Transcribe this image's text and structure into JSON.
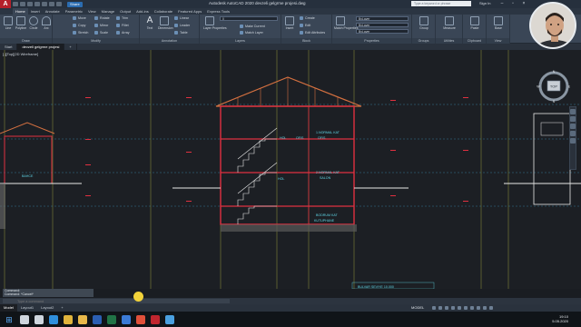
{
  "window": {
    "title": "Autodesk AutoCAD 2020   devzeli gelgrme projesi.dwg",
    "share_label": "Share",
    "help_search_placeholder": "Type a keyword or phrase",
    "signin_label": "Sign In"
  },
  "ribbon_tabs": [
    "Home",
    "Insert",
    "Annotate",
    "Parametric",
    "View",
    "Manage",
    "Output",
    "Add-ins",
    "Collaborate",
    "Featured Apps",
    "Express Tools"
  ],
  "ribbon": {
    "draw": {
      "label": "Draw",
      "tools": [
        "Line",
        "Polyline",
        "Circle",
        "Arc"
      ]
    },
    "modify": {
      "label": "Modify",
      "tools": [
        "Move",
        "Rotate",
        "Trim",
        "Copy",
        "Mirror",
        "Fillet",
        "Stretch",
        "Scale",
        "Array"
      ]
    },
    "annotation": {
      "label": "Annotation",
      "tools": [
        "Text",
        "Dimension",
        "Linear",
        "Leader",
        "Table"
      ]
    },
    "layers": {
      "label": "Layers",
      "tools": [
        "Layer Properties",
        "Make Current",
        "Match Layer"
      ]
    },
    "block": {
      "label": "Block",
      "tools": [
        "Insert",
        "Create",
        "Edit",
        "Edit Attributes"
      ]
    },
    "properties": {
      "label": "Properties",
      "tools": [
        "Match Properties"
      ],
      "combos": [
        "ByLayer",
        "ByLayer",
        "ByLayer"
      ]
    },
    "groups": {
      "label": "Groups",
      "tools": [
        "Group"
      ]
    },
    "utilities": {
      "label": "Utilities",
      "tools": [
        "Measure"
      ]
    },
    "clipboard": {
      "label": "Clipboard",
      "tools": [
        "Paste"
      ]
    },
    "view": {
      "label": "View",
      "tools": [
        "Base"
      ]
    }
  },
  "file_tabs": [
    "Start",
    "devzeli gelgrme projesi"
  ],
  "viewport_label": "[-][Top][2D Wireframe]",
  "drawing": {
    "room_labels": [
      "HOL",
      "OFIS",
      "1.NORMAL KAT",
      "OFIS",
      "HOL",
      "2.NORMAL KAT",
      "SALON",
      "BODRUM KAT",
      "KUTUPHANE",
      "BAHCE"
    ],
    "title_block": "BULVAR SEVIYE 10.000"
  },
  "viewcube": {
    "face": "TOP",
    "north": "N",
    "east": "E",
    "south": "S",
    "west": "W",
    "wcs": "WCS"
  },
  "command": {
    "history": [
      "Command:",
      "Command:  *Cancel*"
    ],
    "placeholder": "Type a command"
  },
  "layout_tabs": [
    "Model",
    "Layout1",
    "Layout2"
  ],
  "status": {
    "model": "MODEL"
  },
  "clock": {
    "time": "19:10",
    "date": "5.05.2020"
  },
  "taskbar_icons": [
    {
      "name": "search-icon",
      "color": "#cfd6de"
    },
    {
      "name": "task-view-icon",
      "color": "#cfd6de"
    },
    {
      "name": "edge-icon",
      "color": "#2f8fdc"
    },
    {
      "name": "chrome-icon",
      "color": "#e0b43c"
    },
    {
      "name": "explorer-icon",
      "color": "#e8b84a"
    },
    {
      "name": "word-icon",
      "color": "#2b5fb3"
    },
    {
      "name": "excel-icon",
      "color": "#217346"
    },
    {
      "name": "store-icon",
      "color": "#3b7bd6"
    },
    {
      "name": "media-icon",
      "color": "#e0503a"
    },
    {
      "name": "autocad-icon",
      "color": "#c0262f"
    },
    {
      "name": "camera-icon",
      "color": "#4aa0e0"
    }
  ],
  "colors": {
    "canvas": "#1c1f24",
    "wall": "#e03040",
    "roof": "#d47040",
    "stairs": "#e8e8e8",
    "text_cyan": "#5fd6e6",
    "grid": "#d0d34a",
    "accent": "#2b6cb0"
  }
}
